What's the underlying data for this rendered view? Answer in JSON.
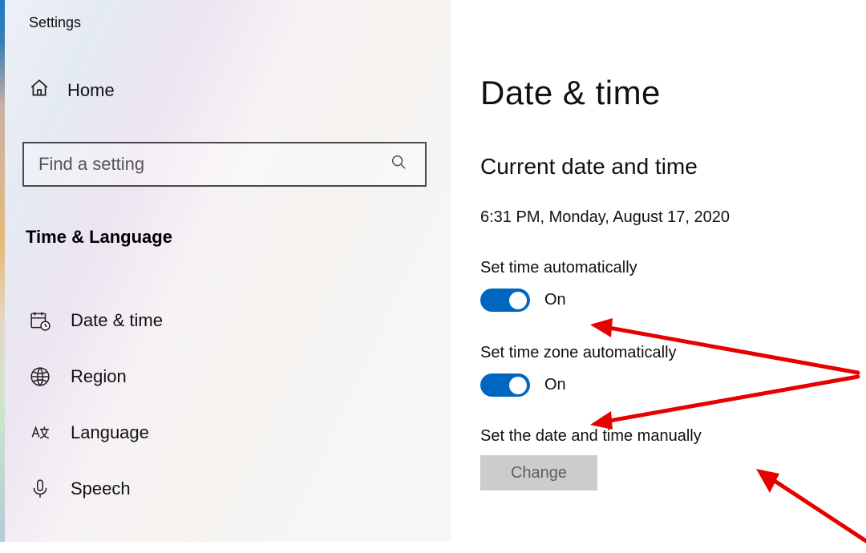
{
  "window": {
    "title": "Settings"
  },
  "sidebar": {
    "home_label": "Home",
    "search_placeholder": "Find a setting",
    "category_heading": "Time & Language",
    "items": [
      {
        "label": "Date & time",
        "icon": "calendar-clock-icon",
        "active": true
      },
      {
        "label": "Region",
        "icon": "globe-icon",
        "active": false
      },
      {
        "label": "Language",
        "icon": "language-icon",
        "active": false
      },
      {
        "label": "Speech",
        "icon": "microphone-icon",
        "active": false
      }
    ]
  },
  "main": {
    "page_title": "Date & time",
    "subheading": "Current date and time",
    "current_datetime": "6:31 PM, Monday, August 17, 2020",
    "toggle1": {
      "label": "Set time automatically",
      "state_text": "On",
      "value": true
    },
    "toggle2": {
      "label": "Set time zone automatically",
      "state_text": "On",
      "value": true
    },
    "manual": {
      "label": "Set the date and time manually",
      "button_label": "Change",
      "enabled": false
    }
  },
  "annotation": {
    "arrow_color": "#e60000"
  }
}
